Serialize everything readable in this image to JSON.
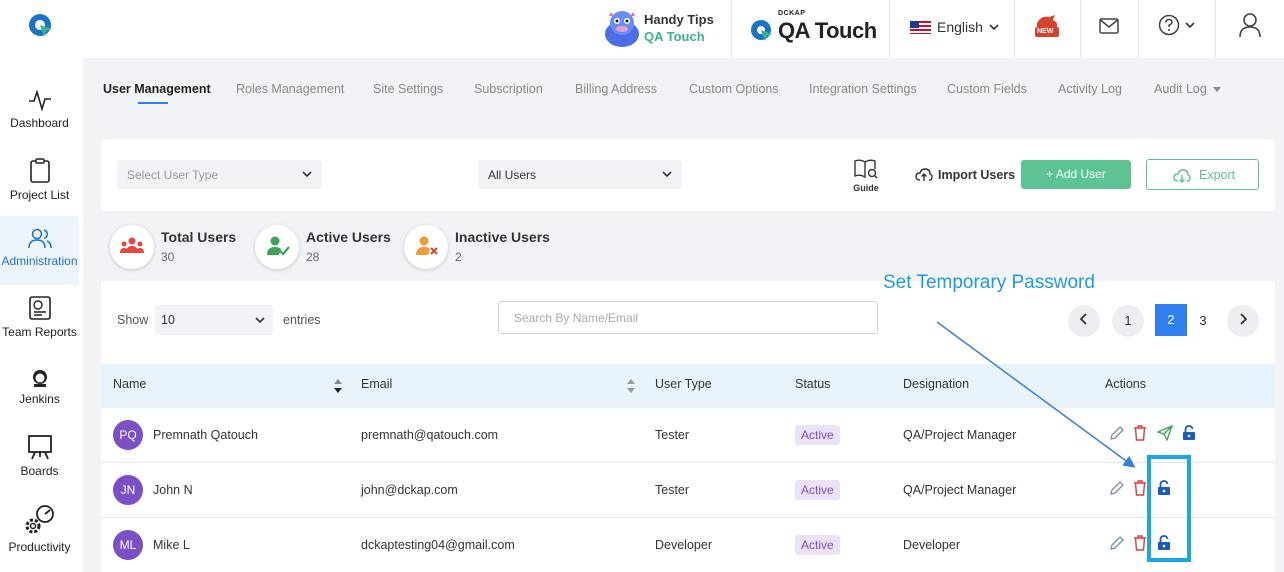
{
  "header": {
    "handy_tips_line1": "Handy Tips",
    "handy_tips_line2": "QA Touch",
    "brand_small": "DCKAP",
    "brand_name": "QA Touch",
    "language": "English",
    "new_badge": "NEW"
  },
  "sidebar": {
    "items": [
      {
        "label": "Dashboard",
        "icon": "pulse-icon"
      },
      {
        "label": "Project List",
        "icon": "clipboard-icon"
      },
      {
        "label": "Administration",
        "icon": "users-icon"
      },
      {
        "label": "Team Reports",
        "icon": "report-icon"
      },
      {
        "label": "Jenkins",
        "icon": "jenkins-icon"
      },
      {
        "label": "Boards",
        "icon": "board-icon"
      },
      {
        "label": "Productivity",
        "icon": "gears-icon"
      }
    ],
    "active": "Administration"
  },
  "tabs": [
    "User Management",
    "Roles Management",
    "Site Settings",
    "Subscription",
    "Billing Address",
    "Custom Options",
    "Integration Settings",
    "Custom Fields",
    "Activity Log",
    "Audit Log"
  ],
  "filters": {
    "user_type_placeholder": "Select User Type",
    "user_scope": "All Users",
    "guide_label": "Guide",
    "import_label": "Import Users",
    "add_label": "+ Add User",
    "export_label": "Export"
  },
  "stats": [
    {
      "title": "Total Users",
      "value": "30",
      "color": "#e8453c"
    },
    {
      "title": "Active Users",
      "value": "28",
      "color": "#3aa655"
    },
    {
      "title": "Inactive Users",
      "value": "2",
      "color": "#f29c38"
    }
  ],
  "table_controls": {
    "show_label": "Show",
    "entries_value": "10",
    "entries_label": "entries",
    "search_placeholder": "Search By Name/Email",
    "pages": [
      "1",
      "2",
      "3"
    ],
    "current_page": "2"
  },
  "table": {
    "headers": [
      "Name",
      "Email",
      "User Type",
      "Status",
      "Designation",
      "Actions"
    ],
    "rows": [
      {
        "initials": "PQ",
        "name": "Premnath Qatouch",
        "email": "premnath@qatouch.com",
        "user_type": "Tester",
        "status": "Active",
        "designation": "QA/Project Manager"
      },
      {
        "initials": "JN",
        "name": "John N",
        "email": "john@dckap.com",
        "user_type": "Tester",
        "status": "Active",
        "designation": "QA/Project Manager"
      },
      {
        "initials": "ML",
        "name": "Mike L",
        "email": "dckaptesting04@gmail.com",
        "user_type": "Developer",
        "status": "Active",
        "designation": "Developer"
      }
    ]
  },
  "annotation": {
    "text": "Set Temporary Password",
    "color": "#1e9be0"
  },
  "colors": {
    "primary": "#2f80ed",
    "success": "#5cc394",
    "badge": "#7a50c4"
  }
}
